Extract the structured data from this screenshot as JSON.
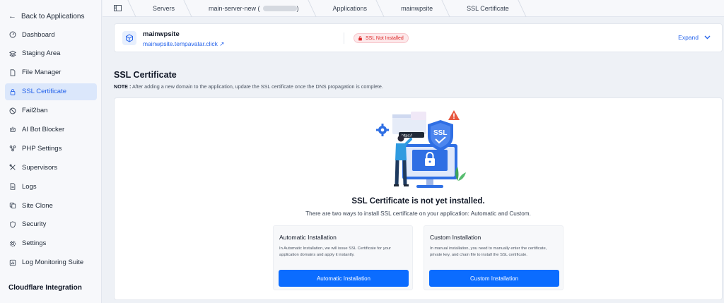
{
  "sidebar": {
    "back_label": "Back to Applications",
    "items": [
      {
        "label": "Dashboard",
        "icon": "dashboard-gauge-icon"
      },
      {
        "label": "Staging Area",
        "icon": "stack-icon"
      },
      {
        "label": "File Manager",
        "icon": "file-icon"
      },
      {
        "label": "SSL Certificate",
        "icon": "lock-icon",
        "active": true
      },
      {
        "label": "Fail2ban",
        "icon": "ban-icon"
      },
      {
        "label": "AI Bot Blocker",
        "icon": "robot-icon"
      },
      {
        "label": "PHP Settings",
        "icon": "nodes-icon"
      },
      {
        "label": "Supervisors",
        "icon": "tools-icon"
      },
      {
        "label": "Logs",
        "icon": "document-icon"
      },
      {
        "label": "Site Clone",
        "icon": "copy-icon"
      },
      {
        "label": "Security",
        "icon": "shield-icon"
      },
      {
        "label": "Settings",
        "icon": "gear-icon"
      },
      {
        "label": "Log Monitoring Suite",
        "icon": "chart-icon"
      }
    ],
    "cloudflare_label": "Cloudflare Integration"
  },
  "breadcrumb": {
    "items": [
      "Servers",
      "main-server-new (",
      "Applications",
      "mainwpsite",
      "SSL Certificate"
    ]
  },
  "app": {
    "name": "mainwpsite",
    "domain": "mainwpsite.tempavatar.click",
    "status": "SSL Not Installed",
    "expand_label": "Expand"
  },
  "page": {
    "title": "SSL Certificate",
    "note_prefix": "NOTE :",
    "note_text": "After adding a new domain to the application, update the SSL certificate once the DNS propagation is complete."
  },
  "empty_state": {
    "heading": "SSL Certificate is not yet installed.",
    "subheading": "There are two ways to install SSL certificate on your application: Automatic and Custom.",
    "illustration_ssl_text": "SSL",
    "illustration_url_text": "https://"
  },
  "options": {
    "automatic": {
      "title": "Automatic Installation",
      "description": "In Automatic Installation, we will issue SSL Certificate for your application domains and apply it instantly.",
      "button": "Automatic Installation"
    },
    "custom": {
      "title": "Custom Installation",
      "description": "In manual installation, you need to manually enter the certificate, private key, and chain file to install the SSL certificate.",
      "button": "Custom Installation"
    }
  },
  "colors": {
    "accent": "#2563eb",
    "button": "#0b6cff",
    "danger": "#dc2626",
    "active_bg": "#dbe7fb"
  }
}
